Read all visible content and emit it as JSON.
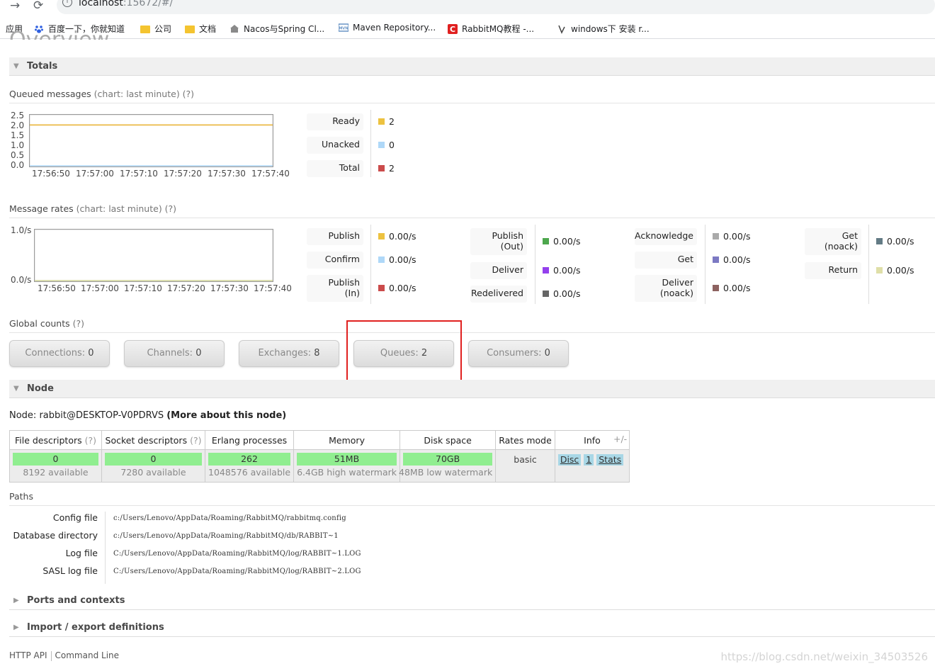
{
  "browser": {
    "url_host": "localhost",
    "url_rest": ":15672/#/",
    "bookmarks": [
      "应用",
      "百度一下，你就知道",
      "公司",
      "文档",
      "Nacos与Spring Cl...",
      "Maven Repository...",
      "RabbitMQ教程 -...",
      "windows下 安装 r..."
    ]
  },
  "page": {
    "title": "Overview"
  },
  "totals": {
    "section_label": "Totals",
    "queued": {
      "label": "Queued messages",
      "hint": "(chart: last minute) (?)",
      "legend": [
        {
          "label": "Ready",
          "value": "2",
          "color": "#edc240"
        },
        {
          "label": "Unacked",
          "value": "0",
          "color": "#afd8f8"
        },
        {
          "label": "Total",
          "value": "2",
          "color": "#cb4b4b"
        }
      ]
    },
    "rates": {
      "label": "Message rates",
      "hint": "(chart: last minute) (?)",
      "groups": [
        [
          {
            "label": "Publish",
            "value": "0.00/s",
            "color": "#edc240"
          },
          {
            "label": "Confirm",
            "value": "0.00/s",
            "color": "#afd8f8"
          },
          {
            "label": "Publish\n(In)",
            "value": "0.00/s",
            "color": "#cb4b4b"
          }
        ],
        [
          {
            "label": "Publish\n(Out)",
            "value": "0.00/s",
            "color": "#4da74d"
          },
          {
            "label": "Deliver",
            "value": "0.00/s",
            "color": "#9440ed"
          },
          {
            "label": "Redelivered",
            "value": "0.00/s",
            "color": "#666666"
          }
        ],
        [
          {
            "label": "Acknowledge",
            "value": "0.00/s",
            "color": "#aaaaaa"
          },
          {
            "label": "Get",
            "value": "0.00/s",
            "color": "#7c79c3"
          },
          {
            "label": "Deliver\n(noack)",
            "value": "0.00/s",
            "color": "#8d6260"
          }
        ],
        [
          {
            "label": "Get\n(noack)",
            "value": "0.00/s",
            "color": "#637b85"
          },
          {
            "label": "Return",
            "value": "0.00/s",
            "color": "#dfdfa8"
          }
        ]
      ]
    }
  },
  "chart_data": [
    {
      "type": "line",
      "x": [
        "17:56:50",
        "17:57:00",
        "17:57:10",
        "17:57:20",
        "17:57:30",
        "17:57:40"
      ],
      "yticks": [
        "2.5",
        "2.0",
        "1.5",
        "1.0",
        "0.5",
        "0.0"
      ],
      "ylim": [
        0,
        2.5
      ],
      "series": [
        {
          "name": "Total",
          "values": [
            2,
            2,
            2,
            2,
            2,
            2
          ],
          "color": "#cb4b4b"
        },
        {
          "name": "Ready",
          "values": [
            2,
            2,
            2,
            2,
            2,
            2
          ],
          "color": "#edc240"
        },
        {
          "name": "Unacked",
          "values": [
            0,
            0,
            0,
            0,
            0,
            0
          ],
          "color": "#afd8f8"
        }
      ]
    },
    {
      "type": "line",
      "x": [
        "17:56:50",
        "17:57:00",
        "17:57:10",
        "17:57:20",
        "17:57:30",
        "17:57:40"
      ],
      "yticks": [
        "1.0/s",
        "0.0/s"
      ],
      "ylim": [
        0,
        1
      ],
      "series": [
        {
          "name": "Publish",
          "values": [
            0,
            0,
            0,
            0,
            0,
            0
          ],
          "color": "#edc240"
        },
        {
          "name": "Confirm",
          "values": [
            0,
            0,
            0,
            0,
            0,
            0
          ],
          "color": "#afd8f8"
        },
        {
          "name": "Return",
          "values": [
            0,
            0,
            0,
            0,
            0,
            0
          ],
          "color": "#dfdfa8"
        }
      ]
    }
  ],
  "global": {
    "label": "Global counts",
    "hint": "(?)",
    "items": [
      {
        "label": "Connections:",
        "value": "0"
      },
      {
        "label": "Channels:",
        "value": "0"
      },
      {
        "label": "Exchanges:",
        "value": "8"
      },
      {
        "label": "Queues:",
        "value": "2"
      },
      {
        "label": "Consumers:",
        "value": "0"
      }
    ]
  },
  "node": {
    "section_label": "Node",
    "prefix": "Node: rabbit@DESKTOP-V0PDRVS",
    "more_link": "(More about this node)",
    "headers": [
      "File descriptors",
      "Socket descriptors",
      "Erlang processes",
      "Memory",
      "Disk space",
      "Rates mode",
      "Info"
    ],
    "hint": "(?)",
    "plus_minus": "+/-",
    "file_descriptors": {
      "value": "0",
      "sub": "8192 available"
    },
    "socket_descriptors": {
      "value": "0",
      "sub": "7280 available"
    },
    "erlang_processes": {
      "value": "262",
      "sub": "1048576 available"
    },
    "memory": {
      "value": "51MB",
      "sub": "6.4GB high watermark"
    },
    "disk": {
      "value": "70GB",
      "sub": "48MB low watermark"
    },
    "rates_mode": "basic",
    "info": [
      "Disc",
      "1",
      "Stats"
    ]
  },
  "paths": {
    "label": "Paths",
    "rows": [
      {
        "label": "Config file",
        "value": "c:/Users/Lenovo/AppData/Roaming/RabbitMQ/rabbitmq.config"
      },
      {
        "label": "Database directory",
        "value": "c:/Users/Lenovo/AppData/Roaming/RabbitMQ/db/RABBIT~1"
      },
      {
        "label": "Log file",
        "value": "C:/Users/Lenovo/AppData/Roaming/RabbitMQ/log/RABBIT~1.LOG"
      },
      {
        "label": "SASL log file",
        "value": "C:/Users/Lenovo/AppData/Roaming/RabbitMQ/log/RABBIT~2.LOG"
      }
    ]
  },
  "sections": {
    "ports": "Ports and contexts",
    "import_export": "Import / export definitions"
  },
  "footer": {
    "http_api": "HTTP API",
    "command_line": "Command Line",
    "watermark": "https://blog.csdn.net/weixin_34503526"
  }
}
